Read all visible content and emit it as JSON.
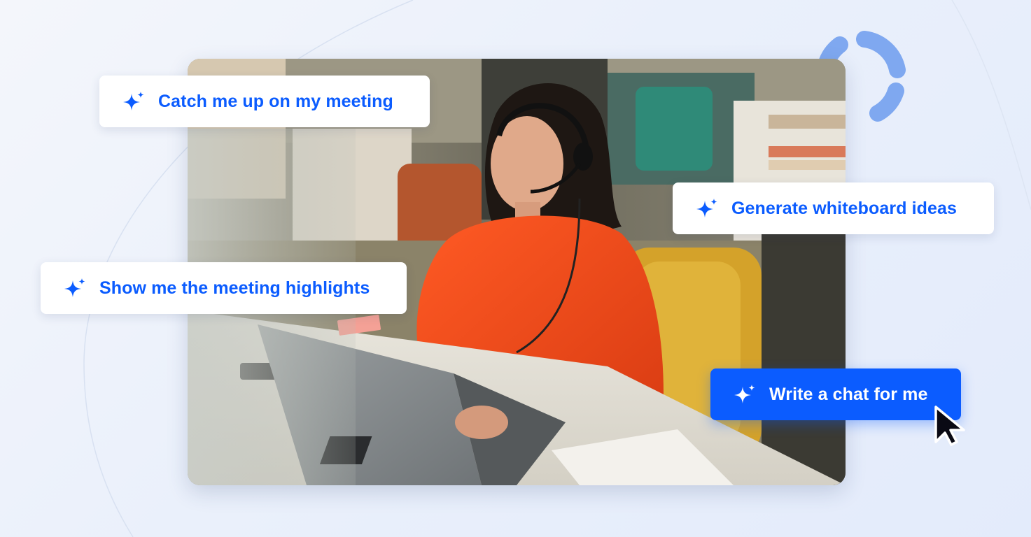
{
  "prompts": [
    {
      "label": "Catch me up on my meeting",
      "icon": "sparkle-icon",
      "active": false
    },
    {
      "label": "Generate whiteboard ideas",
      "icon": "sparkle-icon",
      "active": false
    },
    {
      "label": "Show me the meeting highlights",
      "icon": "sparkle-icon",
      "active": false
    },
    {
      "label": "Write a chat for me",
      "icon": "sparkle-icon",
      "active": true
    }
  ],
  "colors": {
    "accent": "#0b5cff",
    "chip_background": "#ffffff",
    "active_chip_background": "#0b5cff",
    "decor_ring": "#7fa8f0",
    "page_background": "#eef2fa"
  },
  "decor": {
    "cursor": "mouse-pointer-icon",
    "ring": "dashed-ring-icon",
    "photo": "woman with headset typing on laptop in office"
  }
}
